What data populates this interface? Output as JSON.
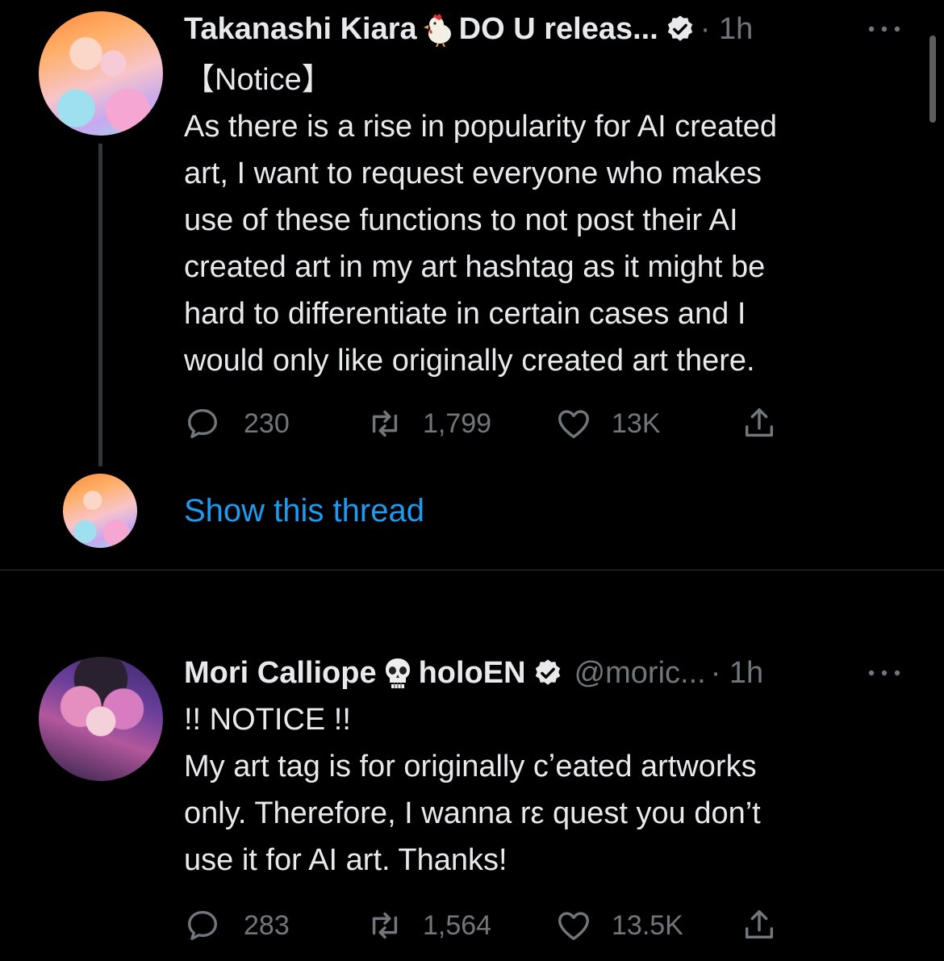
{
  "tweets": [
    {
      "display_name": "Takanashi Kiara",
      "name_emoji": "chicken-icon",
      "name_suffix": "DO U releas...",
      "verified": true,
      "handle": "",
      "time": "· 1h",
      "text_lines": [
        "【Notice】",
        "As there is a rise in popularity for AI created",
        "art, I want to request everyone who makes",
        "use of these functions to not post their AI",
        "created art in my art hashtag as it might be",
        "hard to differentiate in certain cases and I",
        "would only like originally created art there."
      ],
      "replies": "230",
      "retweets": "1,799",
      "likes": "13K",
      "show_thread_label": "Show this thread"
    },
    {
      "display_name": "Mori Calliope",
      "name_emoji": "skull-icon",
      "name_suffix": "holoEN",
      "verified": true,
      "handle": "@moric...",
      "time": "· 1h",
      "text_lines": [
        "!! NOTICE !!",
        "My art tag is for originally cʼeated artworks",
        "only. Therefore, I wanna rε quest you don’t",
        "use it for AI art. Thanks!"
      ],
      "replies": "283",
      "retweets": "1,564",
      "likes": "13.5K"
    }
  ],
  "colors": {
    "background": "#000000",
    "text_primary": "#e7e9ea",
    "text_secondary": "#71767b",
    "link": "#1d9bf0",
    "divider": "#2f3336"
  },
  "icons": [
    "reply-icon",
    "retweet-icon",
    "like-icon",
    "share-icon",
    "verified-icon",
    "more-icon"
  ]
}
